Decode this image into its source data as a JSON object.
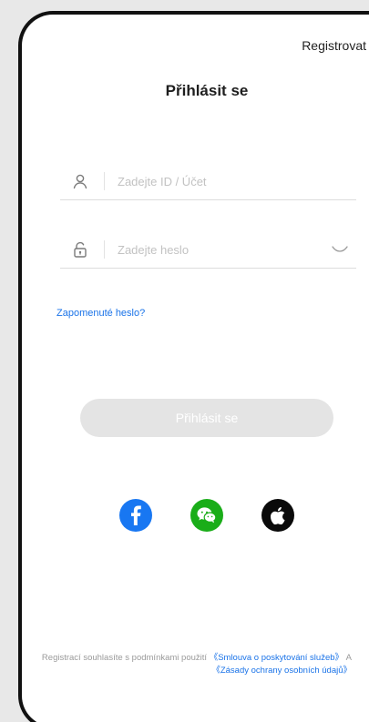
{
  "header": {
    "register_label": "Registrovat"
  },
  "title": "Přihlásit se",
  "fields": {
    "account_placeholder": "Zadejte ID / Účet",
    "password_placeholder": "Zadejte heslo"
  },
  "forgot_password": "Zapomenuté heslo?",
  "login_button": "Přihlásit se",
  "social": {
    "icons": [
      "facebook-icon",
      "wechat-icon",
      "apple-icon"
    ],
    "colors": {
      "facebook": "#1877f2",
      "wechat": "#1aad19",
      "apple": "#0a0a0a"
    }
  },
  "terms": {
    "prefix": "Registrací souhlasíte s podmínkami použití ",
    "link1": "《Smlouva o poskytování služeb》",
    "joiner": " A ",
    "link2": "《Zásady ochrany osobních údajů》"
  },
  "colors": {
    "accent": "#1a73e8",
    "button_disabled": "#e4e4e4"
  }
}
